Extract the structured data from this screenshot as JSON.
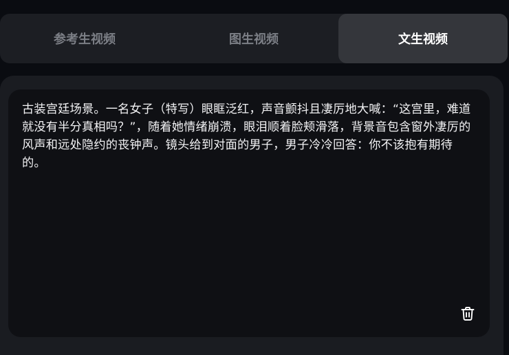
{
  "tabs": [
    {
      "label": "参考生视频",
      "active": false
    },
    {
      "label": "图生视频",
      "active": false
    },
    {
      "label": "文生视频",
      "active": true
    }
  ],
  "editor": {
    "prompt": "古装宫廷场景。一名女子（特写）眼眶泛红，声音颤抖且凄厉地大喊：“这宫里，难道就没有半分真相吗？”，随着她情绪崩溃，眼泪顺着脸颊滑落，背景音包含窗外凄厉的风声和远处隐约的丧钟声。镜头给到对面的男子，男子冷冷回答：你不该抱有期待的。",
    "delete_icon": "trash-icon"
  },
  "colors": {
    "background": "#0a0c11",
    "tab_bar": "#1c1e23",
    "tab_active": "#34363b",
    "tab_inactive_text": "#7c7f86",
    "editor_bg": "#0f1014",
    "text": "#f2f2f4"
  }
}
